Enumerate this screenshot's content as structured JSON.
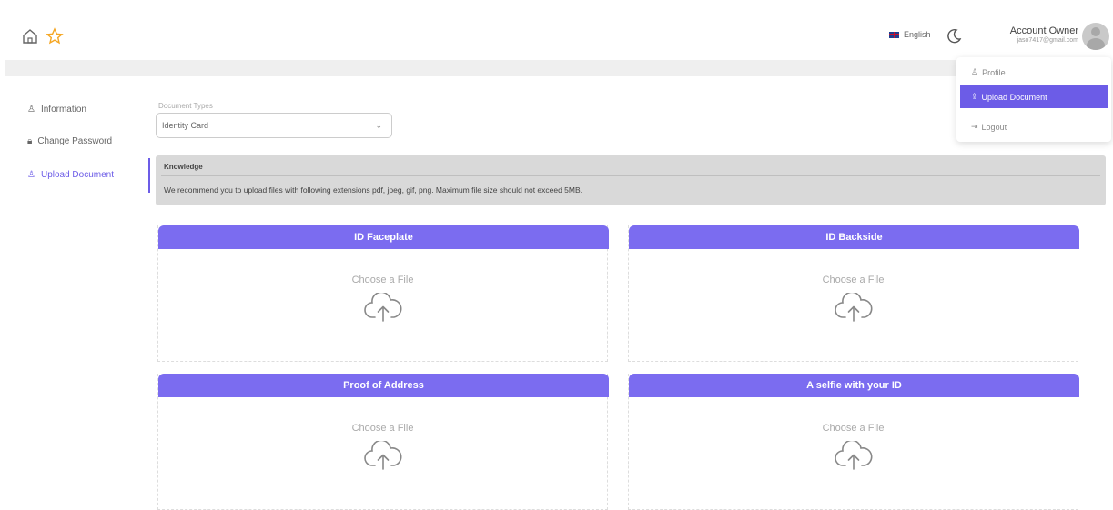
{
  "header": {
    "language": "English",
    "account_name": "Account Owner",
    "account_email": "jaso7417@gmail.com"
  },
  "dropdown": {
    "items": [
      {
        "label": "Profile",
        "icon": "user-icon"
      },
      {
        "label": "Upload Document",
        "icon": "upload-doc-icon"
      },
      {
        "label": "Logout",
        "icon": "logout-icon"
      }
    ],
    "active_index": 1
  },
  "sidenav": {
    "items": [
      {
        "label": "Information",
        "icon": "user-icon"
      },
      {
        "label": "Change Password",
        "icon": "lock-icon"
      },
      {
        "label": "Upload Document",
        "icon": "upload-user-icon"
      }
    ],
    "active_index": 2
  },
  "form": {
    "document_types_label": "Document Types",
    "document_type_value": "Identity Card"
  },
  "knowledge": {
    "title": "Knowledge",
    "text": "We recommend you to upload files with following extensions pdf, jpeg, gif, png. Maximum file size should not exceed 5MB."
  },
  "cards": [
    {
      "title": "ID Faceplate",
      "choose": "Choose a File"
    },
    {
      "title": "ID Backside",
      "choose": "Choose a File"
    },
    {
      "title": "Proof of Address",
      "choose": "Choose a File"
    },
    {
      "title": "A selfie with your ID",
      "choose": "Choose a File"
    }
  ],
  "colors": {
    "accent": "#6c5ce7",
    "card_header": "#7b6cf0",
    "star": "#f5a623"
  }
}
